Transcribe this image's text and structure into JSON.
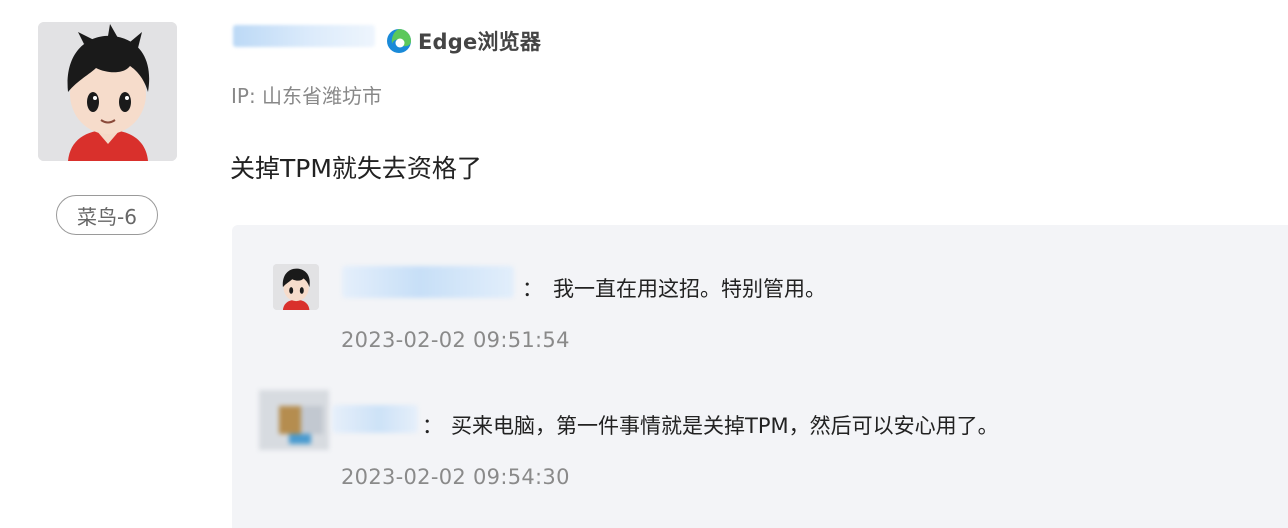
{
  "post": {
    "browser_label": "Edge浏览器",
    "browser_icon": "edge-browser-icon",
    "ip_location": "IP: 山东省潍坊市",
    "content": "关掉TPM就失去资格了",
    "level_badge": "菜鸟-6"
  },
  "replies": [
    {
      "colon": "：",
      "text": "我一直在用这招。特别管用。",
      "time": "2023-02-02 09:51:54"
    },
    {
      "colon": "：",
      "text": "买来电脑，第一件事情就是关掉TPM，然后可以安心用了。",
      "time": "2023-02-02 09:54:30"
    }
  ],
  "colors": {
    "reply_bg": "#f3f4f7",
    "edge_blue": "#1a8ad8",
    "edge_green": "#5bc85b"
  }
}
